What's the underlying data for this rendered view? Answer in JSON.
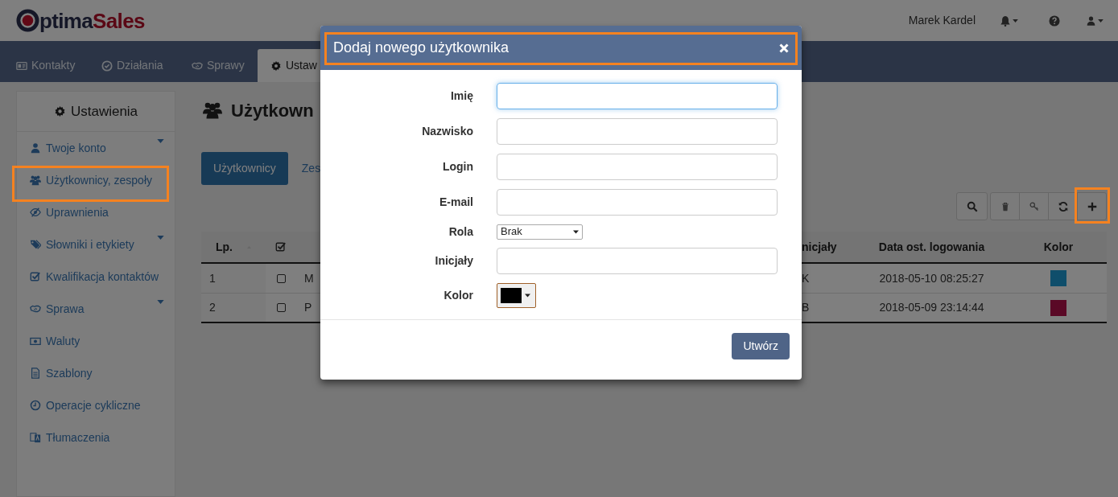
{
  "header": {
    "logo": {
      "part_1": "ptima",
      "part_2": "Sales"
    },
    "user_name": "Marek Kardel"
  },
  "nav_tabs": [
    {
      "label": "Kontakty",
      "selected": false
    },
    {
      "label": "Działania",
      "selected": false
    },
    {
      "label": "Sprawy",
      "selected": false
    },
    {
      "label": "Ustaw",
      "selected": true
    }
  ],
  "sidebar": {
    "title": "Ustawienia",
    "items": [
      {
        "label": "Twoje konto",
        "expandable": true,
        "highlighted": false
      },
      {
        "label": "Użytkownicy, zespoły",
        "expandable": false,
        "highlighted": true
      },
      {
        "label": "Uprawnienia",
        "expandable": false,
        "highlighted": false
      },
      {
        "label": "Słowniki i etykiety",
        "expandable": true,
        "highlighted": false
      },
      {
        "label": "Kwalifikacja kontaktów",
        "expandable": false,
        "highlighted": false
      },
      {
        "label": "Sprawa",
        "expandable": true,
        "highlighted": false
      },
      {
        "label": "Waluty",
        "expandable": false,
        "highlighted": false
      },
      {
        "label": "Szablony",
        "expandable": false,
        "highlighted": false
      },
      {
        "label": "Operacje cykliczne",
        "expandable": false,
        "highlighted": false
      },
      {
        "label": "Tłumaczenia",
        "expandable": false,
        "highlighted": false
      }
    ]
  },
  "page": {
    "title": "Użytkown",
    "tabs": [
      {
        "label": "Użytkownicy",
        "selected": true
      },
      {
        "label": "Zes",
        "selected": false
      }
    ]
  },
  "toolbar": [
    {
      "highlighted": false
    },
    {
      "highlighted": false
    },
    {
      "highlighted": false
    },
    {
      "highlighted": false
    },
    {
      "highlighted": true
    }
  ],
  "table": {
    "columns": {
      "lp": "Lp.",
      "initials": "nicjały",
      "last_login": "Data ost. logowania",
      "kolor": "Kolor"
    },
    "rows": [
      {
        "lp": "1",
        "checked": false,
        "column_3": "M",
        "initials": "K",
        "last_login": "2018-05-10 08:25:27",
        "color": "#0f4e6b"
      },
      {
        "lp": "2",
        "checked": false,
        "column_3": "P",
        "initials": "B",
        "last_login": "2018-05-09 23:14:44",
        "color": "#5a0926"
      }
    ]
  },
  "modal": {
    "title": "Dodaj nowego użytkownika",
    "highlighted": true,
    "fields": [
      {
        "kind": "text",
        "label": "Imię",
        "focused": true
      },
      {
        "kind": "text",
        "label": "Nazwisko",
        "focused": false
      },
      {
        "kind": "text",
        "label": "Login",
        "focused": false
      },
      {
        "kind": "text",
        "label": "E-mail",
        "focused": false
      },
      {
        "kind": "select",
        "label": "Rola",
        "value": "Brak"
      },
      {
        "kind": "text",
        "label": "Inicjały",
        "focused": false
      },
      {
        "kind": "color",
        "label": "Kolor",
        "color": "#000000"
      }
    ],
    "submit": "Utwórz"
  }
}
